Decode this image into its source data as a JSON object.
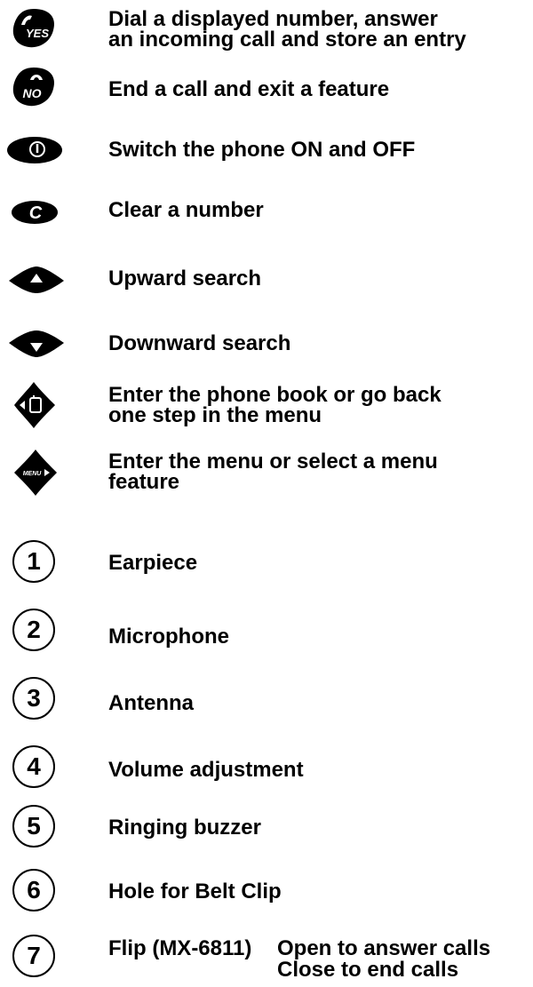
{
  "keys": [
    {
      "icon": "yes-key-icon",
      "icon_text": "YES",
      "lines": [
        "Dial a displayed number, answer",
        "an incoming call and store an entry"
      ]
    },
    {
      "icon": "no-key-icon",
      "icon_text": "NO",
      "lines": [
        "End a call and exit a feature"
      ]
    },
    {
      "icon": "power-key-icon",
      "lines": [
        "Switch the phone ON and OFF"
      ]
    },
    {
      "icon": "clear-key-icon",
      "icon_text": "C",
      "lines": [
        "Clear a number"
      ]
    },
    {
      "icon": "up-key-icon",
      "lines": [
        "Upward search"
      ]
    },
    {
      "icon": "down-key-icon",
      "lines": [
        "Downward search"
      ]
    },
    {
      "icon": "phonebook-key-icon",
      "lines": [
        "Enter the phone book or go back",
        "one step in the menu"
      ]
    },
    {
      "icon": "menu-key-icon",
      "icon_text": "MENU",
      "lines": [
        "Enter the menu or select a menu",
        "feature"
      ]
    }
  ],
  "parts": [
    {
      "number": "1",
      "label": "Earpiece"
    },
    {
      "number": "2",
      "label": "Microphone"
    },
    {
      "number": "3",
      "label": "Antenna"
    },
    {
      "number": "4",
      "label": "Volume adjustment"
    },
    {
      "number": "5",
      "label": "Ringing buzzer"
    },
    {
      "number": "6",
      "label": "Hole for Belt Clip"
    },
    {
      "number": "7",
      "label_prefix": "Flip (MX-6811)",
      "lines": [
        "Open to answer calls",
        "Close to end calls"
      ]
    }
  ]
}
